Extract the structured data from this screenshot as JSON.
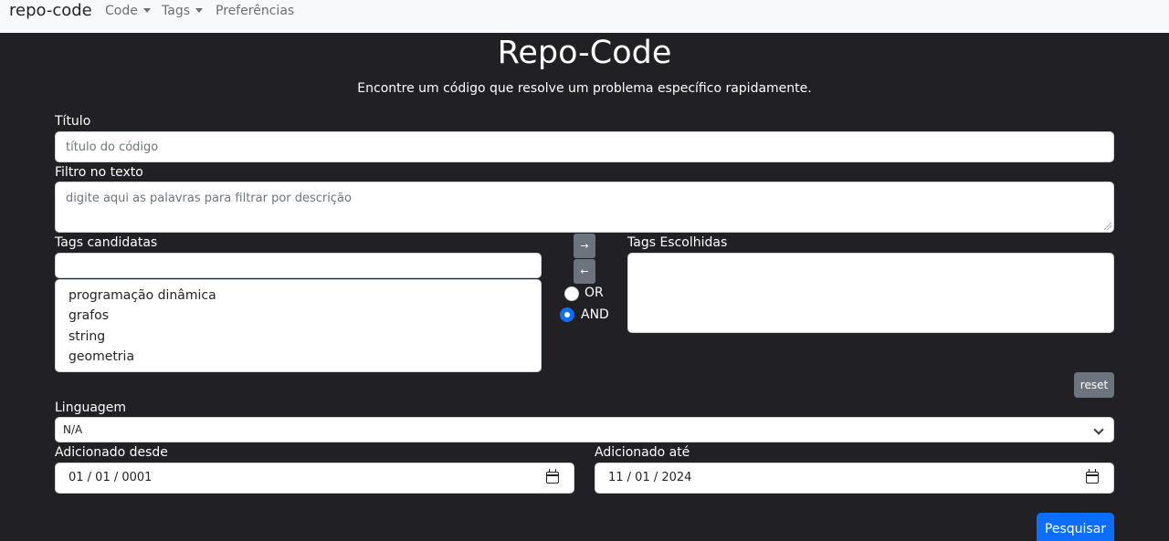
{
  "navbar": {
    "brand": "repo-code",
    "items": [
      {
        "label": "Code",
        "dropdown": true
      },
      {
        "label": "Tags",
        "dropdown": true
      },
      {
        "label": "Preferências",
        "dropdown": false
      }
    ]
  },
  "header": {
    "title": "Repo-Code",
    "subtitle": "Encontre um código que resolve um problema específico rapidamente."
  },
  "form": {
    "title_label": "Título",
    "title_placeholder": "título do código",
    "text_filter_label": "Filtro no texto",
    "text_filter_placeholder": "digite aqui as palavras para filtrar por descrição",
    "candidate_tags_label": "Tags candidatas",
    "candidate_tags_search_value": "",
    "candidate_tags": [
      "programação dinâmica",
      "grafos",
      "string",
      "geometria"
    ],
    "move_right_glyph": "→",
    "move_left_glyph": "←",
    "logic_options": [
      {
        "label": "OR",
        "selected": false
      },
      {
        "label": "AND",
        "selected": true
      }
    ],
    "chosen_tags_label": "Tags Escolhidas",
    "chosen_tags": [],
    "reset_label": "reset",
    "language_label": "Linguagem",
    "language_value": "N/A",
    "added_since_label": "Adicionado desde",
    "added_since_value": "01 / 01 / 0001",
    "added_until_label": "Adicionado até",
    "added_until_value": "11 / 01 / 2024",
    "search_label": "Pesquisar"
  },
  "colors": {
    "background": "#212025",
    "navbar": "#f8f9fa",
    "primary": "#0d6efd",
    "secondary": "#6c757d"
  }
}
